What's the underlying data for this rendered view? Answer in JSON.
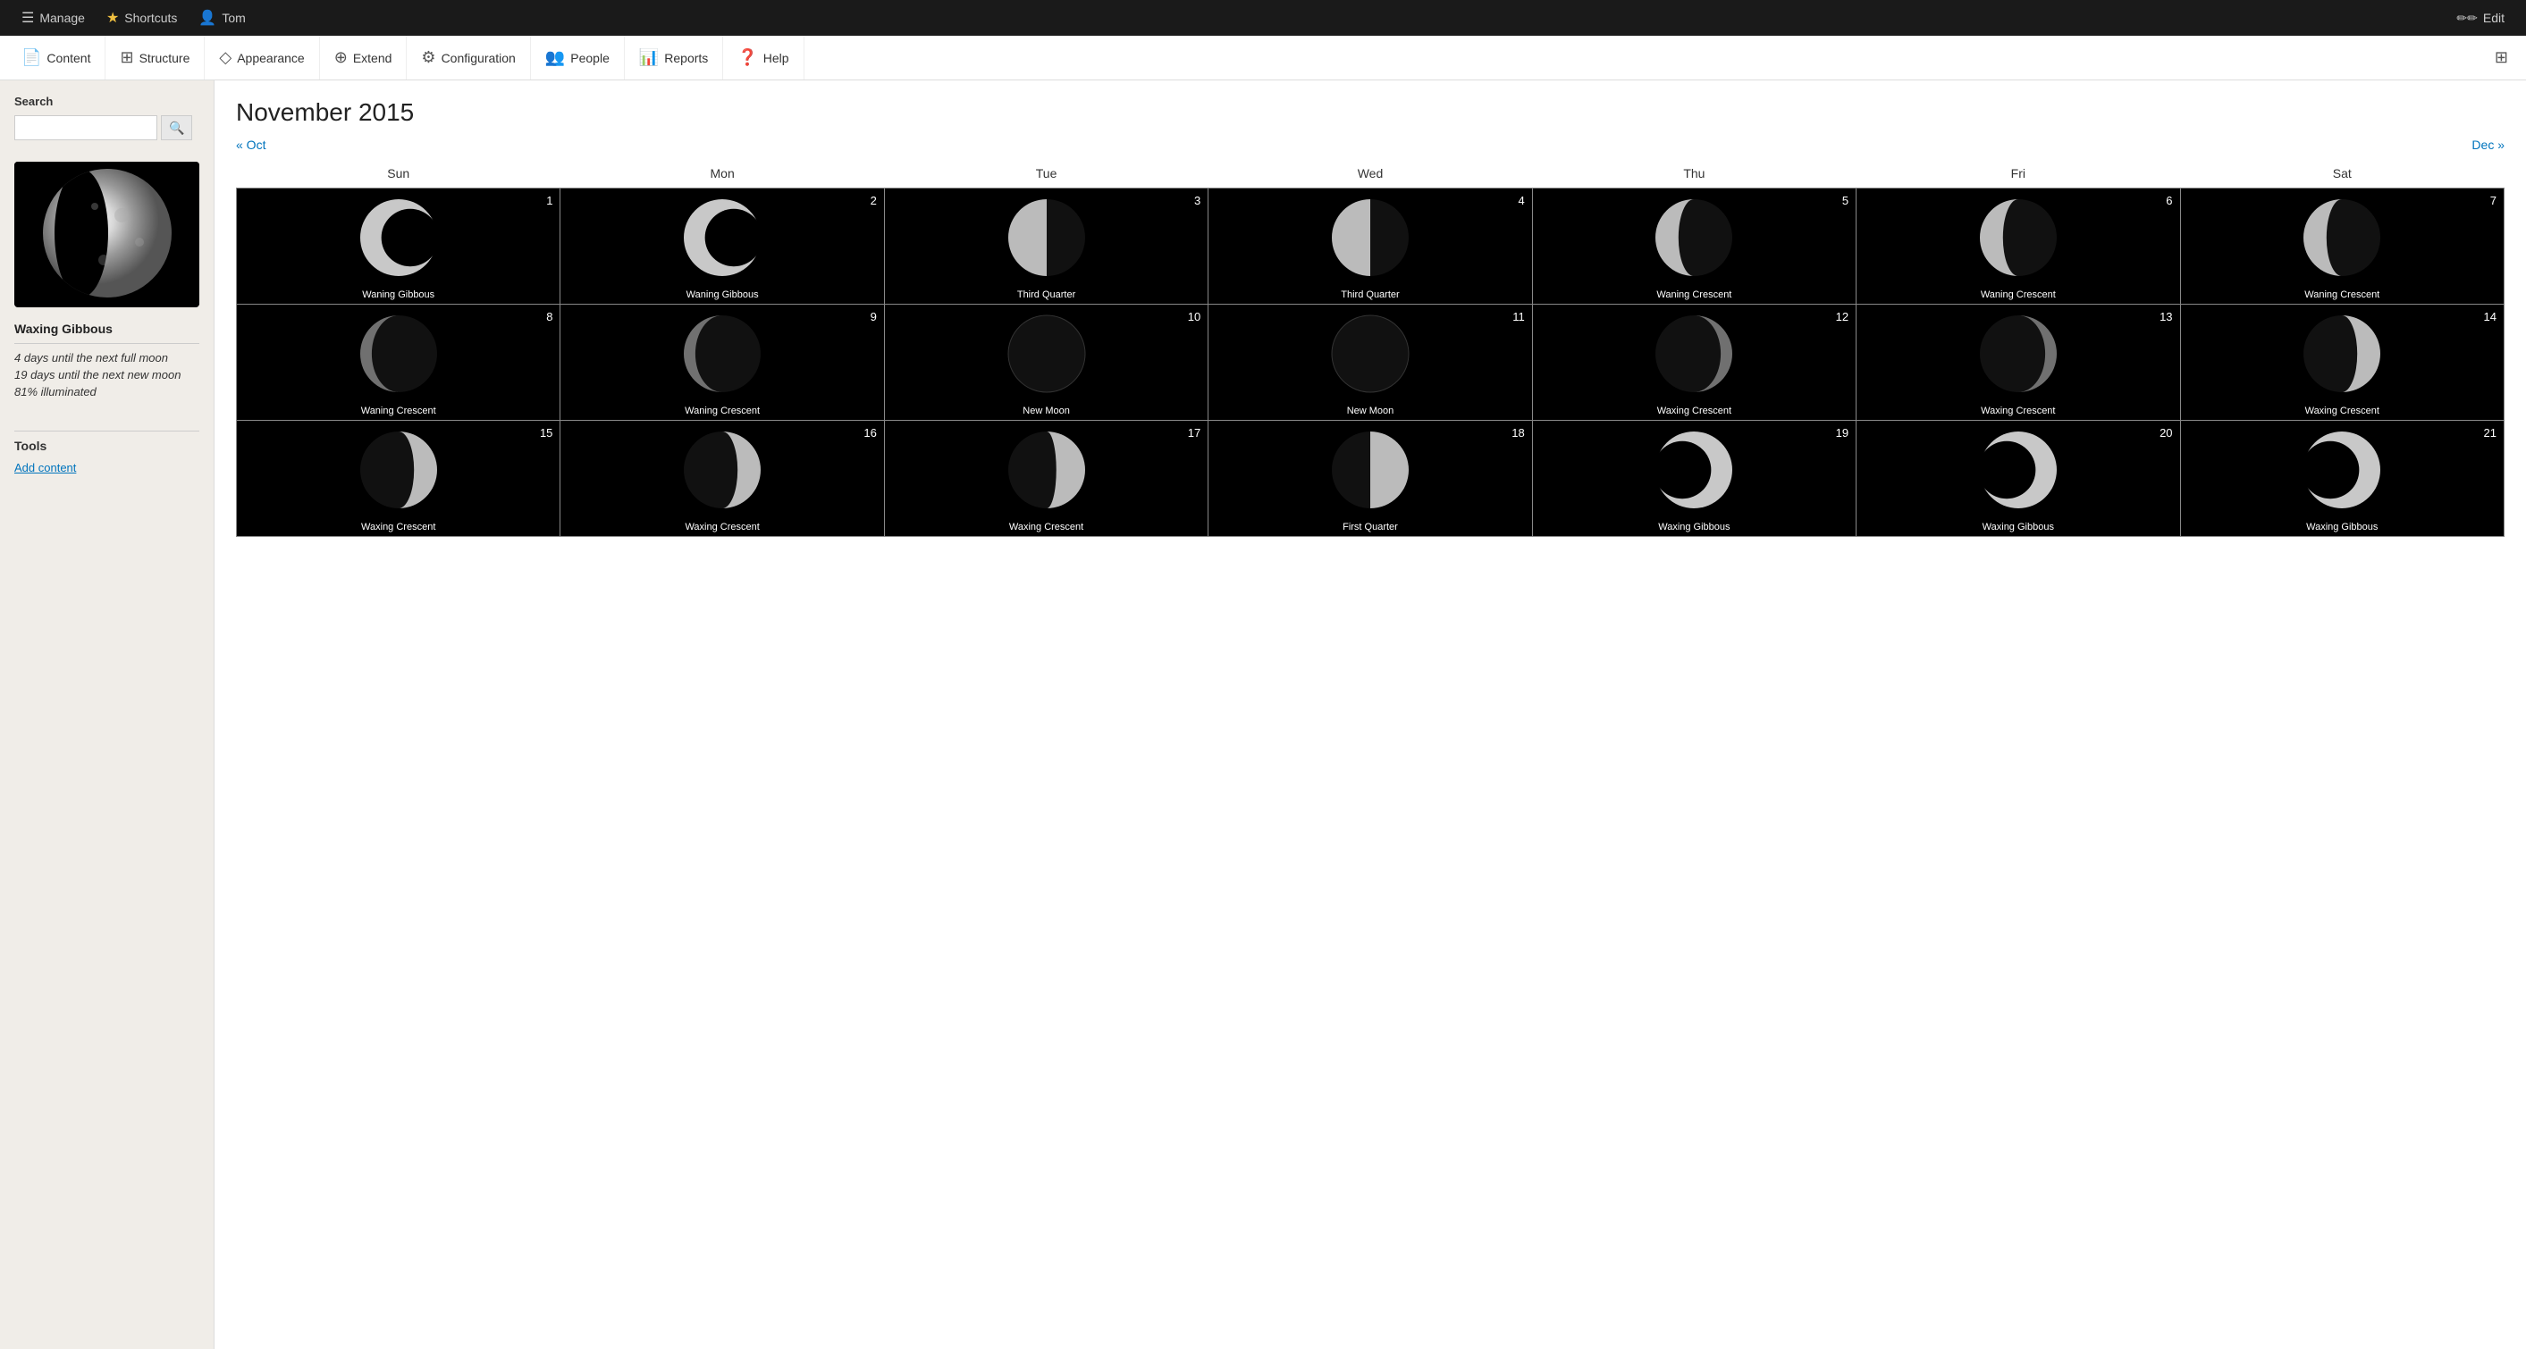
{
  "adminBar": {
    "manage": "Manage",
    "shortcuts": "Shortcuts",
    "user": "Tom",
    "edit": "Edit"
  },
  "nav": {
    "items": [
      {
        "label": "Content",
        "icon": "📄"
      },
      {
        "label": "Structure",
        "icon": "🔧"
      },
      {
        "label": "Appearance",
        "icon": "🎨"
      },
      {
        "label": "Extend",
        "icon": "🧩"
      },
      {
        "label": "Configuration",
        "icon": "⚙"
      },
      {
        "label": "People",
        "icon": "👥"
      },
      {
        "label": "Reports",
        "icon": "📊"
      },
      {
        "label": "Help",
        "icon": "❓"
      }
    ]
  },
  "sidebar": {
    "searchLabel": "Search",
    "searchPlaceholder": "",
    "moonTitle": "Waxing Gibbous",
    "moonStats": [
      "4 days until the next full moon",
      "19 days until the next new moon",
      "81% illuminated"
    ],
    "toolsTitle": "Tools",
    "addContentLabel": "Add content"
  },
  "calendar": {
    "title": "November 2015",
    "prevLabel": "« Oct",
    "nextLabel": "Dec »",
    "dayHeaders": [
      "Sun",
      "Mon",
      "Tue",
      "Wed",
      "Thu",
      "Fri",
      "Sat"
    ],
    "weeks": [
      [
        {
          "day": 1,
          "phase": "Waning Gibbous",
          "type": "waning-gibbous"
        },
        {
          "day": 2,
          "phase": "Waning Gibbous",
          "type": "waning-gibbous"
        },
        {
          "day": 3,
          "phase": "Third Quarter",
          "type": "third-quarter"
        },
        {
          "day": 4,
          "phase": "Third Quarter",
          "type": "third-quarter"
        },
        {
          "day": 5,
          "phase": "Waning Crescent",
          "type": "waning-crescent"
        },
        {
          "day": 6,
          "phase": "Waning Crescent",
          "type": "waning-crescent"
        },
        {
          "day": 7,
          "phase": "Waning Crescent",
          "type": "waning-crescent"
        }
      ],
      [
        {
          "day": 8,
          "phase": "Waning Crescent",
          "type": "waning-crescent-thin"
        },
        {
          "day": 9,
          "phase": "Waning Crescent",
          "type": "waning-crescent-thin"
        },
        {
          "day": 10,
          "phase": "New Moon",
          "type": "new-moon"
        },
        {
          "day": 11,
          "phase": "New Moon",
          "type": "new-moon"
        },
        {
          "day": 12,
          "phase": "Waxing Crescent",
          "type": "waxing-crescent-thin"
        },
        {
          "day": 13,
          "phase": "Waxing Crescent",
          "type": "waxing-crescent-thin"
        },
        {
          "day": 14,
          "phase": "Waxing Crescent",
          "type": "waxing-crescent"
        }
      ],
      [
        {
          "day": 15,
          "phase": "Waxing Crescent",
          "type": "waxing-crescent"
        },
        {
          "day": 16,
          "phase": "Waxing Crescent",
          "type": "waxing-crescent"
        },
        {
          "day": 17,
          "phase": "Waxing Crescent",
          "type": "waxing-crescent-med"
        },
        {
          "day": 18,
          "phase": "First Quarter",
          "type": "first-quarter"
        },
        {
          "day": 19,
          "phase": "Waxing Gibbous",
          "type": "waxing-gibbous"
        },
        {
          "day": 20,
          "phase": "Waxing Gibbous",
          "type": "waxing-gibbous"
        },
        {
          "day": 21,
          "phase": "Waxing Gibbous",
          "type": "waxing-gibbous"
        }
      ]
    ]
  }
}
